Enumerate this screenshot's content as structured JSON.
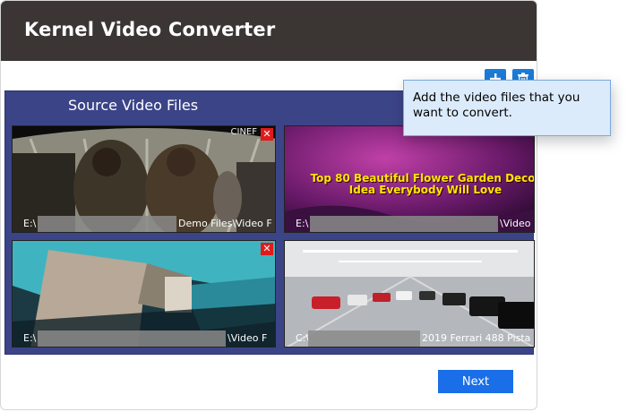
{
  "window": {
    "title": "Kernel Video Converter"
  },
  "toolbar": {
    "add_icon": "plus-icon",
    "delete_icon": "trash-icon"
  },
  "panel": {
    "title": "Source Video Files"
  },
  "videos": [
    {
      "path_start": "E:\\",
      "path_end": "Demo Files\\Video F",
      "overlay_text": "CINEF",
      "has_remove": true
    },
    {
      "path_start": "E:\\",
      "path_end": "\\Video F",
      "overlay_text": "Top 80 Beautiful Flower Garden Decor Idea Everybody Will Love",
      "has_remove": false
    },
    {
      "path_start": "E:\\",
      "path_end": "\\Video F",
      "overlay_text": "",
      "has_remove": true
    },
    {
      "path_start": "C:\\",
      "path_end": "2019 Ferrari 488 Pista - ",
      "overlay_text": "",
      "has_remove": false
    }
  ],
  "remove_glyph": "✕",
  "next_button": {
    "label": "Next"
  },
  "tooltip": {
    "text": "Add the video files that you want to convert."
  },
  "colors": {
    "titlebar": "#3b3634",
    "panel": "#3c4488",
    "accent_blue": "#1a6fe8",
    "remove_red": "#e01b1b",
    "tooltip_bg": "#dcebfb"
  }
}
